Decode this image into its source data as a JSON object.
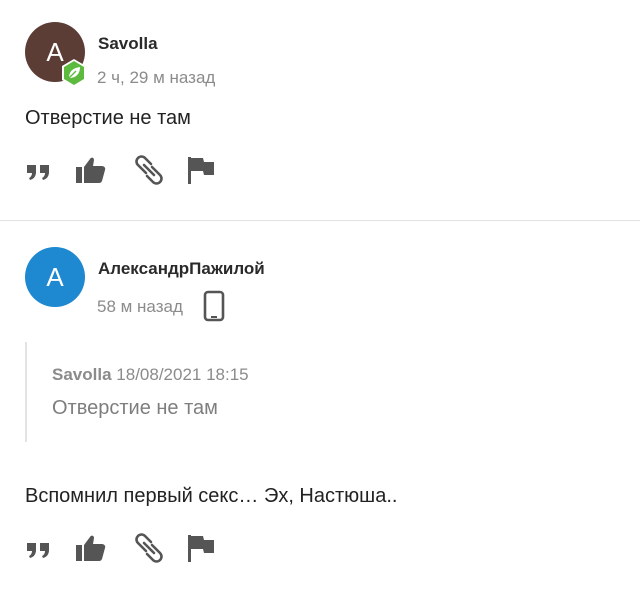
{
  "comments": [
    {
      "avatar_letter": "A",
      "avatar_color": "#5b3d36",
      "author": "Savolla",
      "time": "2 ч, 29 м назад",
      "text": "Отверстие не там",
      "badge_icon": "leaf-badge-icon",
      "badge_color": "#5cbb3f"
    },
    {
      "avatar_letter": "A",
      "avatar_color": "#1e88d0",
      "author": "АлександрПажилой",
      "time": "58 м назад",
      "device_icon": "mobile-phone-icon",
      "quote": {
        "author": "Savolla",
        "date": "18/08/2021 18:15",
        "text": "Отверстие не там"
      },
      "text": "Вспомнил первый секс… Эх, Настюша.."
    }
  ],
  "actions": {
    "icons": [
      "quote-icon",
      "thumbs-up-icon",
      "link-icon",
      "flag-icon"
    ],
    "icon_color": "#555555"
  },
  "colors": {
    "muted_text": "#8b8b8b",
    "divider": "#e2e2e2"
  }
}
